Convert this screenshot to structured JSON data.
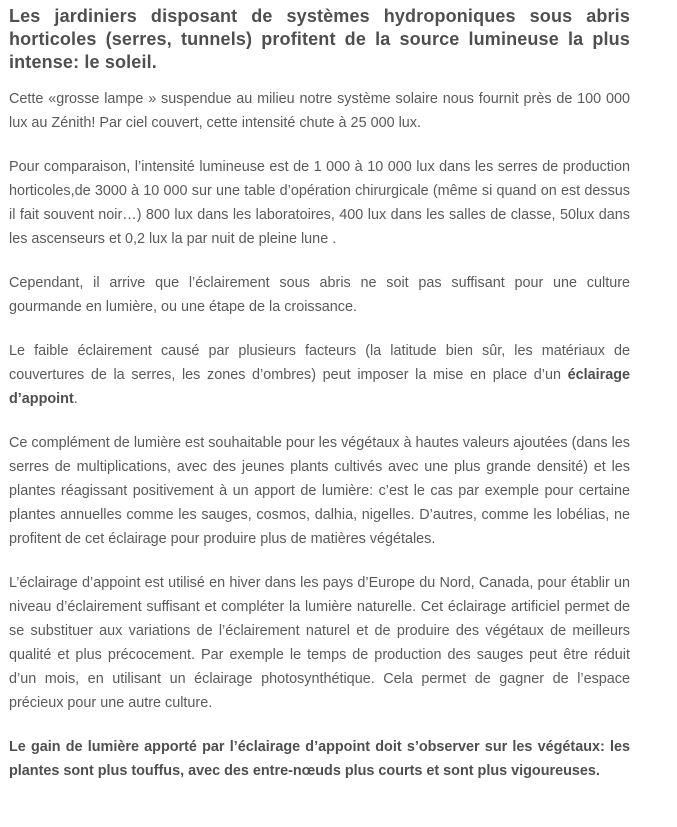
{
  "article": {
    "title": "Les jardiniers disposant de systèmes hydroponiques sous abris horticoles (serres, tunnels) profitent de la source lumineuse la plus intense: le soleil.",
    "paragraphs": [
      "Cette «grosse  lampe » suspendue au milieu notre système solaire nous fournit près de 100 000 lux au Zénith! Par ciel couvert, cette intensité chute à 25 000 lux.",
      "Pour comparaison, l’intensité lumineuse est de 1 000 à 10 000 lux dans les serres de production horticoles,de 3000 à 10 000 sur une table d’opération chirurgicale (même si quand on est dessus il fait souvent noir…) 800 lux dans les laboratoires, 400 lux dans les salles de classe, 50lux dans les ascenseurs et 0,2 lux la par nuit de pleine lune .",
      "Cependant, il arrive que l’éclairement sous abris ne soit pas suffisant pour une culture gourmande en lumière, ou une étape de la croissance.",
      {
        "before": "Le faible éclairement causé par plusieurs facteurs (la latitude bien sûr, les matériaux de couvertures de la serres, les zones d’ombres) peut imposer la mise en place d’un ",
        "bold": "éclairage d’appoint",
        "after": "."
      },
      "Ce complément de lumière est souhaitable pour les végétaux à hautes valeurs ajoutées (dans les serres de multiplications, avec des jeunes plants cultivés avec une plus grande densité) et les plantes réagissant positivement à un apport de lumière: c’est le cas par exemple pour certaine plantes annuelles comme les sauges, cosmos, dalhia, nigelles. D’autres, comme les lobélias, ne profitent de cet éclairage pour produire plus de matières végétales.",
      "L’éclairage d’appoint est utilisé en hiver dans les pays d’Europe du Nord, Canada, pour établir un niveau d’éclairement suffisant et compléter la lumière naturelle. Cet éclairage artificiel permet de se substituer aux variations de l’éclairement naturel et de produire des végétaux de meilleurs qualité et plus précocement. Par exemple le temps de production des sauges peut être réduit d’un mois, en utilisant un éclairage photosynthétique. Cela permet de gagner de l’espace précieux pour une autre culture.",
      "Le gain de lumière apporté par l’éclairage d’appoint doit s’observer sur les végétaux: les plantes sont plus touffus, avec des entre-nœuds plus courts et sont plus vigoureuses."
    ]
  },
  "colors": {
    "text": "#5a5a5a",
    "heading": "#4f4f4f",
    "background": "#ffffff"
  }
}
